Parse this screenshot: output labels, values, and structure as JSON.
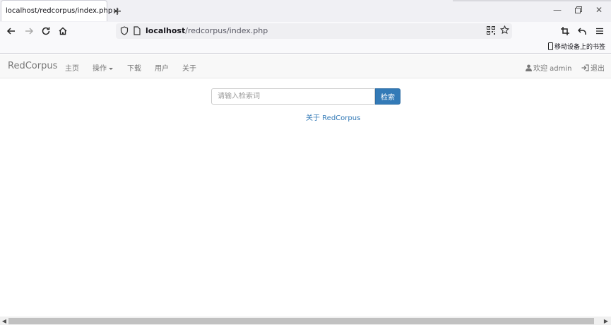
{
  "browser": {
    "tab_title": "localhost/redcorpus/index.php",
    "url_host": "localhost",
    "url_path": "/redcorpus/index.php",
    "bookmark_label": "移动设备上的书签"
  },
  "app": {
    "brand": "RedCorpus",
    "nav": {
      "home": "主页",
      "operations": "操作",
      "download": "下载",
      "users": "用户",
      "about": "关于"
    },
    "welcome": "欢迎 admin",
    "logout": "退出"
  },
  "search": {
    "placeholder": "请输入检索词",
    "button": "检索"
  },
  "about_link": "关于 RedCorpus",
  "colors": {
    "primary": "#337ab7",
    "navbar_bg": "#f8f8f8",
    "nav_text": "#777777"
  }
}
